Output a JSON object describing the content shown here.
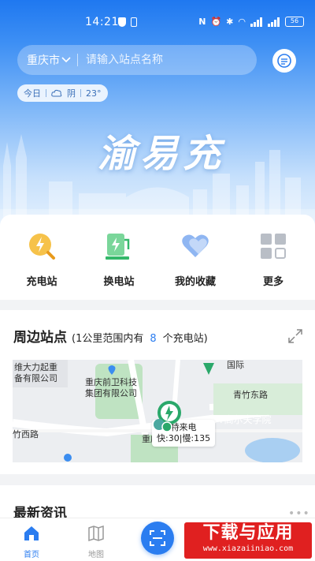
{
  "status_bar": {
    "time": "14:21",
    "battery": "56"
  },
  "search": {
    "city": "重庆市",
    "placeholder": "请输入站点名称"
  },
  "weather": {
    "day": "今日",
    "condition": "阴",
    "temperature": "23°"
  },
  "brand": {
    "title": "渝易充"
  },
  "quick_menu": [
    {
      "label": "充电站",
      "icon": "charging-station-icon"
    },
    {
      "label": "换电站",
      "icon": "battery-swap-icon"
    },
    {
      "label": "我的收藏",
      "icon": "favorite-heart-icon"
    },
    {
      "label": "更多",
      "icon": "more-grid-icon"
    }
  ],
  "nearby": {
    "title": "周边站点",
    "sub_prefix": "(1公里范围内有",
    "count": "8",
    "sub_suffix": "个充电站)"
  },
  "map": {
    "labels": {
      "company1_line1": "维大力起重",
      "company1_line2": "备有限公司",
      "company2_line1": "重庆前卫科技",
      "company2_line2": "集团有限公司",
      "guoji": "国际",
      "road1": "青竹东路",
      "school": "TT高尔夫学院",
      "road2": "竹西路",
      "institute": "重庆市勘测院"
    },
    "callout": {
      "name": "特来电",
      "fast": "快:30",
      "slow": "慢:135"
    }
  },
  "news": {
    "title": "最新资讯",
    "more": "•••"
  },
  "bottom_nav": {
    "home": "首页",
    "map": "地图"
  },
  "watermark": {
    "main": "下载与应用",
    "sub": "www.xiazaiiniao.com"
  },
  "colors": {
    "primary": "#2b7df0",
    "hero_top": "#1f78f0",
    "station_green": "#2aa86a"
  }
}
